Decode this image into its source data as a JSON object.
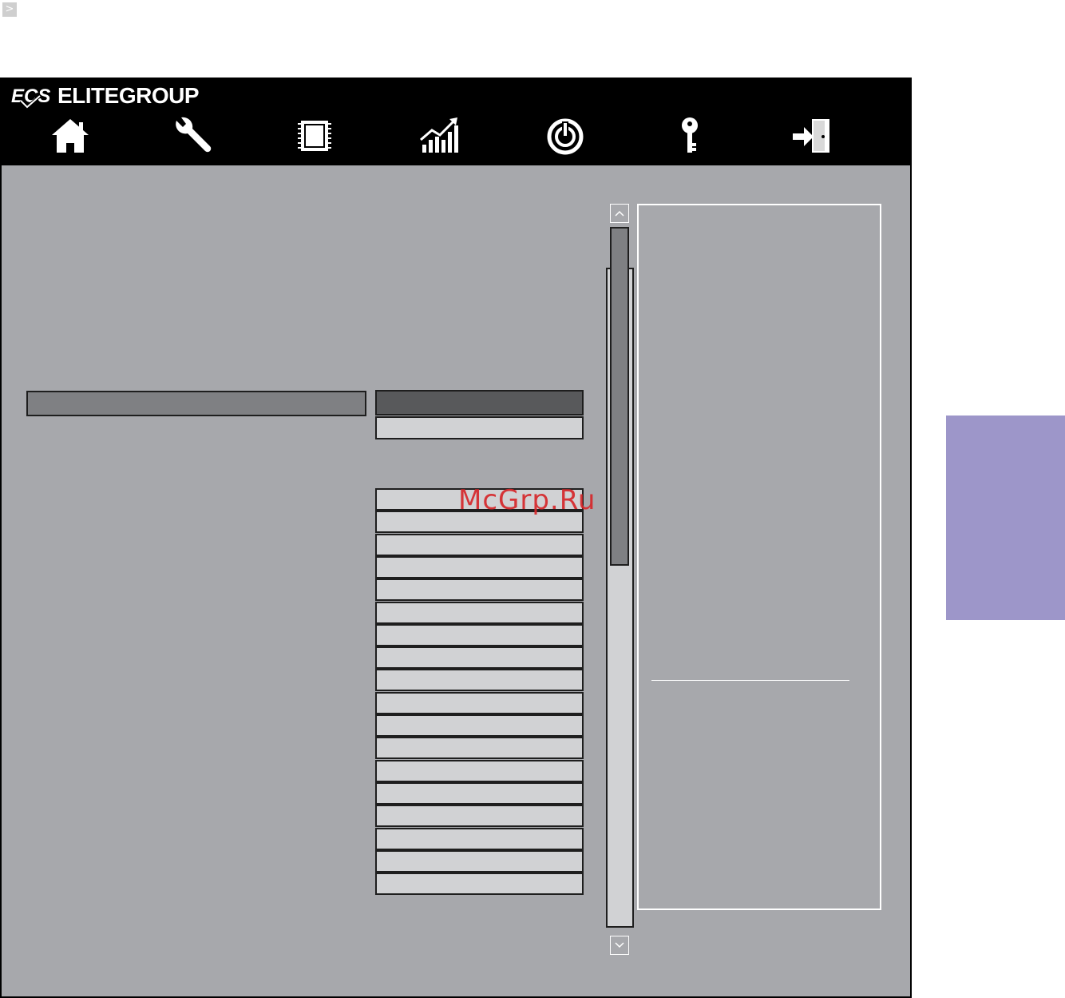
{
  "corner": {
    "glyph": ">"
  },
  "header": {
    "brand": "ELITEGROUP",
    "nav_icons": [
      "home-icon",
      "wrench-icon",
      "chip-icon",
      "chart-icon",
      "power-icon",
      "key-icon",
      "exit-icon"
    ]
  },
  "colors": {
    "background": "#a7a8ac",
    "topbar": "#000000",
    "selected_option": "#58595b",
    "option": "#d1d2d4",
    "highlight_row": "#7f8083",
    "side_tab": "#9d96c9"
  },
  "watermark": {
    "text": "McGrp.Ru"
  },
  "option_list": {
    "count": 18
  }
}
